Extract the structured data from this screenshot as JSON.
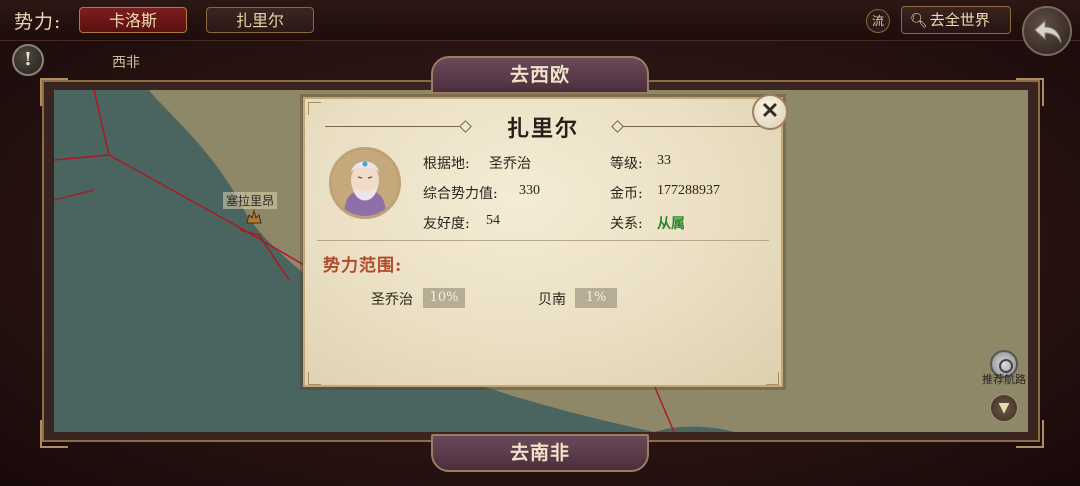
{
  "top_bar": {
    "faction_label": "势力:",
    "tabs": [
      {
        "label": "卡洛斯",
        "active": true
      },
      {
        "label": "扎里尔",
        "active": false
      }
    ],
    "flow_label": "流",
    "world_button": "去全世界"
  },
  "map": {
    "region_name": "西非",
    "nav_north": "去西欧",
    "nav_south": "去南非",
    "city": "塞拉里昂",
    "route_label": "推荐航路"
  },
  "popup": {
    "title": "扎里尔",
    "base_label": "根据地:",
    "base_value": "圣乔治",
    "level_label": "等级:",
    "level_value": "33",
    "power_label": "综合势力值:",
    "power_value": "330",
    "gold_label": "金币:",
    "gold_value": "177288937",
    "friendship_label": "友好度:",
    "friendship_value": "54",
    "relation_label": "关系:",
    "relation_value": "从属",
    "sphere_title": "势力范围:",
    "spheres": [
      {
        "name": "圣乔治",
        "percent": "10%"
      },
      {
        "name": "贝南",
        "percent": "1%"
      }
    ]
  },
  "colors": {
    "active_tab": "#7c1e1e",
    "relation_green": "#2e8a2e",
    "sphere_title": "#b24a2c",
    "sea": "#4a6560",
    "land": "#8e8768",
    "border_line": "#b0141e"
  }
}
